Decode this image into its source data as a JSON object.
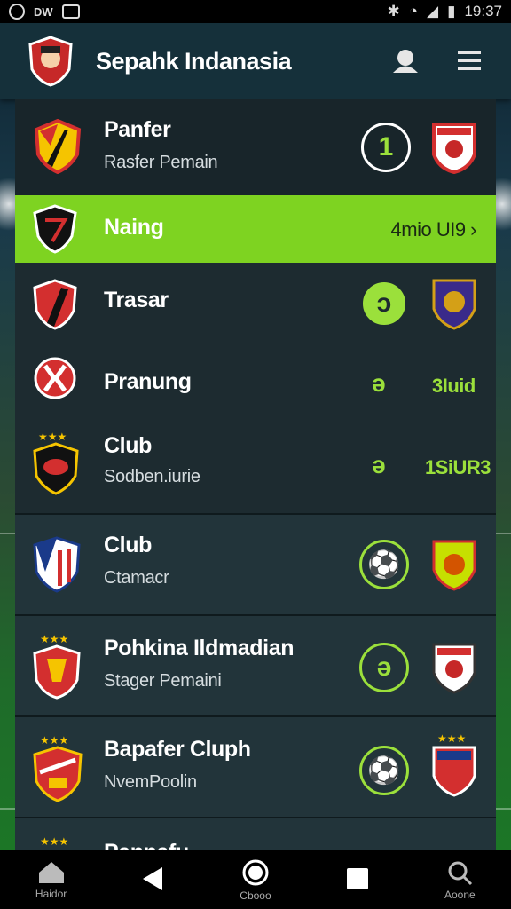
{
  "status_bar": {
    "left_text": "DW",
    "time": "19:37"
  },
  "app_bar": {
    "title": "Sepahk Indanasia"
  },
  "rows": [
    {
      "name": "Panfer",
      "sub": "Rasfer Pemain",
      "badge": "1"
    },
    {
      "name": "Naing",
      "right_text": "4mio UI9 ›"
    },
    {
      "name": "Trasar",
      "badge": "ɔ"
    },
    {
      "name": "Pranung",
      "badge": "ə",
      "score": "3Iuid"
    },
    {
      "name": "Club",
      "sub": "Sodben.iurie",
      "badge": "ə",
      "score": "1SiUR3"
    },
    {
      "name": "Club",
      "sub": "Ctamacr",
      "badge": "⚽"
    },
    {
      "name": "Pohkina Ildmadian",
      "sub": "Stager Pemaini",
      "badge": "ə"
    },
    {
      "name": "Bapafer Cluph",
      "sub": "NvemPoolin",
      "badge": "⚽"
    },
    {
      "name": "Pannafu"
    }
  ],
  "nav": [
    {
      "label": "Haidor",
      "icon": "home-icon"
    },
    {
      "label": "",
      "icon": "back-icon"
    },
    {
      "label": "Cbooo",
      "icon": "home-circle-icon"
    },
    {
      "label": "",
      "icon": "recents-icon"
    },
    {
      "label": "Aoone",
      "icon": "search-icon"
    }
  ],
  "colors": {
    "accent": "#7ed321",
    "header": "#15303a",
    "row": "#1d2b30"
  }
}
